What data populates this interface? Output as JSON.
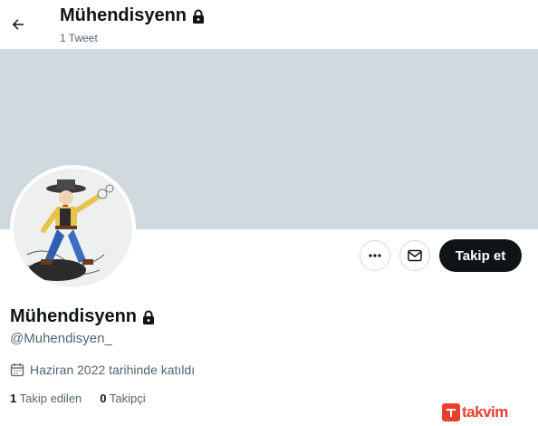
{
  "header": {
    "back_icon": "arrow-left-icon",
    "title": "Mühendisyenn",
    "lock_icon": "lock-icon",
    "subtitle": "1 Tweet"
  },
  "profile": {
    "avatar_alt": "avatar",
    "display_name": "Mühendisyenn",
    "handle": "@Muhendisyen_",
    "joined_icon": "calendar-icon",
    "joined": "Haziran 2022 tarihinde katıldı",
    "following_count": "1",
    "following_label": "Takip edilen",
    "followers_count": "0",
    "followers_label": "Takipçi"
  },
  "actions": {
    "more_icon": "more-horizontal-icon",
    "message_icon": "envelope-icon",
    "follow_label": "Takip et"
  },
  "colors": {
    "banner": "#cfd9de",
    "text_primary": "#0f1419",
    "text_secondary": "#536471",
    "follow_bg": "#0f1419",
    "watermark": "#e8402f"
  },
  "watermark": {
    "text": "takvim"
  }
}
